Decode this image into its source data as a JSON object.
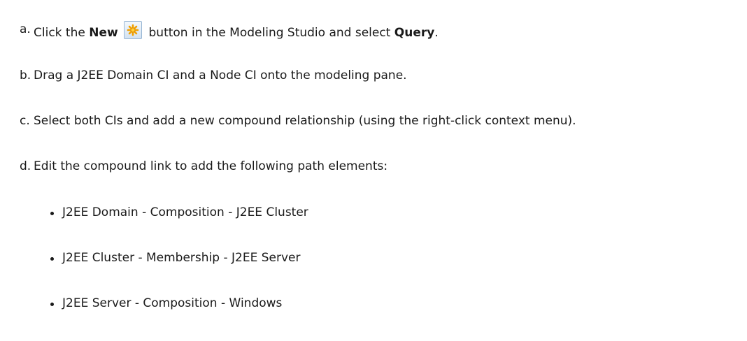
{
  "steps": {
    "a": {
      "marker": "a.",
      "pre": "Click the ",
      "bold1": "New",
      "icon": "new-query-icon",
      "mid": " button in the Modeling Studio and select ",
      "bold2": "Query",
      "post": "."
    },
    "b": {
      "marker": "b.",
      "text": "Drag a J2EE Domain CI and a Node CI onto the modeling pane."
    },
    "c": {
      "marker": "c.",
      "text": "Select both CIs and add a new compound relationship (using the right-click context menu)."
    },
    "d": {
      "marker": "d.",
      "text": "Edit the compound link to add the following path elements:"
    }
  },
  "path_elements": [
    "J2EE Domain - Composition - J2EE Cluster",
    "J2EE Cluster - Membership - J2EE Server",
    "J2EE Server - Composition - Windows"
  ]
}
